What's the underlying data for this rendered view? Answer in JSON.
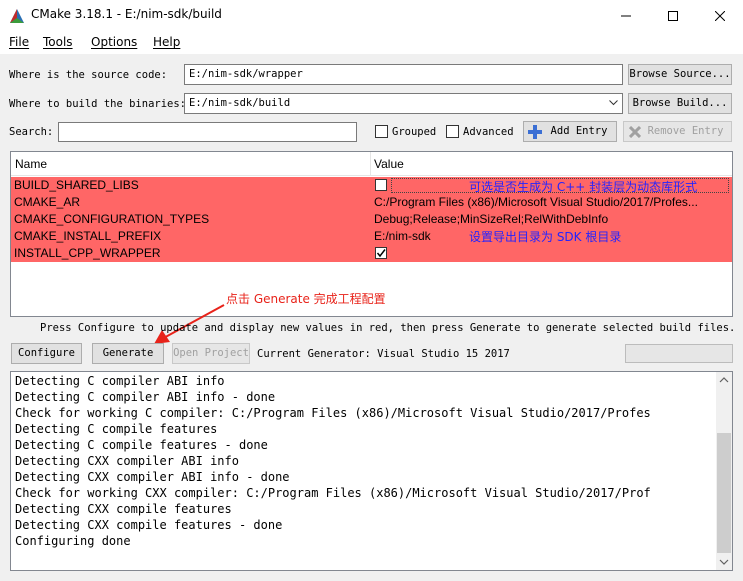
{
  "window": {
    "title": "CMake 3.18.1 - E:/nim-sdk/build"
  },
  "menu": [
    "File",
    "Tools",
    "Options",
    "Help"
  ],
  "source": {
    "label": "Where is the source code:",
    "value": "E:/nim-sdk/wrapper",
    "browse": "Browse Source..."
  },
  "build": {
    "label": "Where to build the binaries:",
    "value": "E:/nim-sdk/build",
    "browse": "Browse Build..."
  },
  "search": {
    "label": "Search:",
    "value": ""
  },
  "options": {
    "grouped": "Grouped",
    "advanced": "Advanced",
    "add_entry": "Add Entry",
    "remove_entry": "Remove Entry"
  },
  "table": {
    "headers": [
      "Name",
      "Value"
    ],
    "rows": [
      {
        "name": "BUILD_SHARED_LIBS",
        "value": "",
        "checkbox": true,
        "checked": false
      },
      {
        "name": "CMAKE_AR",
        "value": "C:/Program Files (x86)/Microsoft Visual Studio/2017/Profes..."
      },
      {
        "name": "CMAKE_CONFIGURATION_TYPES",
        "value": "Debug;Release;MinSizeRel;RelWithDebInfo"
      },
      {
        "name": "CMAKE_INSTALL_PREFIX",
        "value": "E:/nim-sdk"
      },
      {
        "name": "INSTALL_CPP_WRAPPER",
        "value": "",
        "checkbox": true,
        "checked": true
      }
    ]
  },
  "annotations": {
    "shared_libs": "可选是否生成为 C++ 封装层为动态库形式",
    "install_prefix": "设置导出目录为 SDK 根目录",
    "generate": "点击 Generate 完成工程配置"
  },
  "hint": "Press Configure to update and display new values in red, then press Generate to generate selected build files.",
  "actions": {
    "configure": "Configure",
    "generate": "Generate",
    "open_project": "Open Project",
    "current_generator": "Current Generator: Visual Studio 15 2017"
  },
  "output": [
    "Detecting C compiler ABI info",
    "Detecting C compiler ABI info - done",
    "Check for working C compiler: C:/Program Files (x86)/Microsoft Visual Studio/2017/Profes",
    "Detecting C compile features",
    "Detecting C compile features - done",
    "Detecting CXX compiler ABI info",
    "Detecting CXX compiler ABI info - done",
    "Check for working CXX compiler: C:/Program Files (x86)/Microsoft Visual Studio/2017/Prof",
    "Detecting CXX compile features",
    "Detecting CXX compile features - done",
    "Configuring done"
  ],
  "colors": {
    "changed_row": "#ff6666",
    "annotation": "#2424ff",
    "arrow": "#e8231a"
  }
}
